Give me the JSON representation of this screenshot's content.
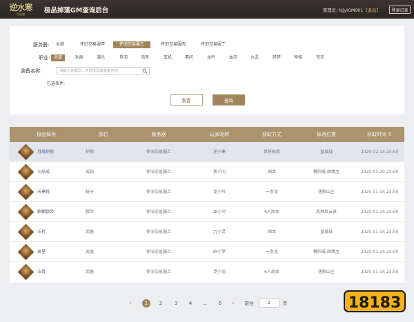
{
  "header": {
    "logo_main": "逆水寒",
    "logo_sub": "怀旧服",
    "title": "极品掉落GM查询后台",
    "admin_prefix": "管理员: hjjylGM001",
    "logout": "【退出】",
    "login_record": "登录记录"
  },
  "filters": {
    "server_label": "服务器:",
    "servers": [
      "全部",
      "怀旧交易服甲",
      "怀旧交易服乙",
      "怀旧交易服丙",
      "怀旧交易服丁"
    ],
    "server_selected": "怀旧交易服乙",
    "class_label": "职业:",
    "classes": [
      "全部",
      "沧澜",
      "潮光",
      "觅羽",
      "鸿音",
      "玄机",
      "素问",
      "龙吟",
      "血河",
      "九灵",
      "碎梦",
      "神相",
      "铁衣"
    ],
    "class_selected": "全部",
    "equip_label": "装备名称:",
    "equip_placeholder": "请输入关键词，并选择添加装备名称",
    "equip_value": "",
    "selected_conditions_label": "已选条件:",
    "reset_label": "重置",
    "query_label": "查询"
  },
  "table": {
    "columns": [
      "极品掉落",
      "部位",
      "服务器",
      "玩家昵称",
      "获取方式",
      "掉落位置",
      "获取时间 ↕"
    ],
    "rows": [
      {
        "name": "月疏护腕",
        "slot": "护腕",
        "server": "怀旧交易服乙",
        "player": "逆小寒",
        "method": "世界拍卖",
        "location": "皇城战",
        "time": "2025-02-14-23:50"
      },
      {
        "name": "火焰戒",
        "slot": "戒指",
        "server": "怀旧交易服乙",
        "player": "素小问",
        "method": "困本",
        "location": "舞阳城-顾鹰主",
        "time": "2025-01-20-23:50"
      },
      {
        "name": "天寒靴",
        "slot": "鞋子",
        "server": "怀旧交易服乙",
        "player": "龙小吟",
        "method": "一条龙",
        "location": "落鹤山庄",
        "time": "2025-01-14-23:50"
      },
      {
        "name": "麒麟腰带",
        "slot": "腰带",
        "server": "怀旧交易服乙",
        "player": "血小河",
        "method": "6人周本",
        "location": "武林风云录",
        "time": "2025-01-14-23:50"
      },
      {
        "name": "玉衬",
        "slot": "武器",
        "server": "怀旧交易服乙",
        "player": "九小灵",
        "method": "困本",
        "location": "皇城战",
        "time": "2025-01-14-23:50"
      },
      {
        "name": "珠星",
        "slot": "武器",
        "server": "怀旧交易服乙",
        "player": "碎小梦",
        "method": "一条龙",
        "location": "舞阳城-顾鹰主",
        "time": "2025-01-14-23:50"
      },
      {
        "name": "玉骨",
        "slot": "武器",
        "server": "怀旧交易服乙",
        "player": "觅小羽",
        "method": "6人周本",
        "location": "落鹤山庄",
        "time": "2025-01-14-23:50"
      }
    ]
  },
  "pagination": {
    "pages": [
      "1",
      "2",
      "3",
      "4",
      "...",
      "6"
    ],
    "current": "1",
    "goto_label": "前往",
    "goto_value": "2",
    "page_suffix": "页"
  },
  "watermark": {
    "text": "18183"
  }
}
